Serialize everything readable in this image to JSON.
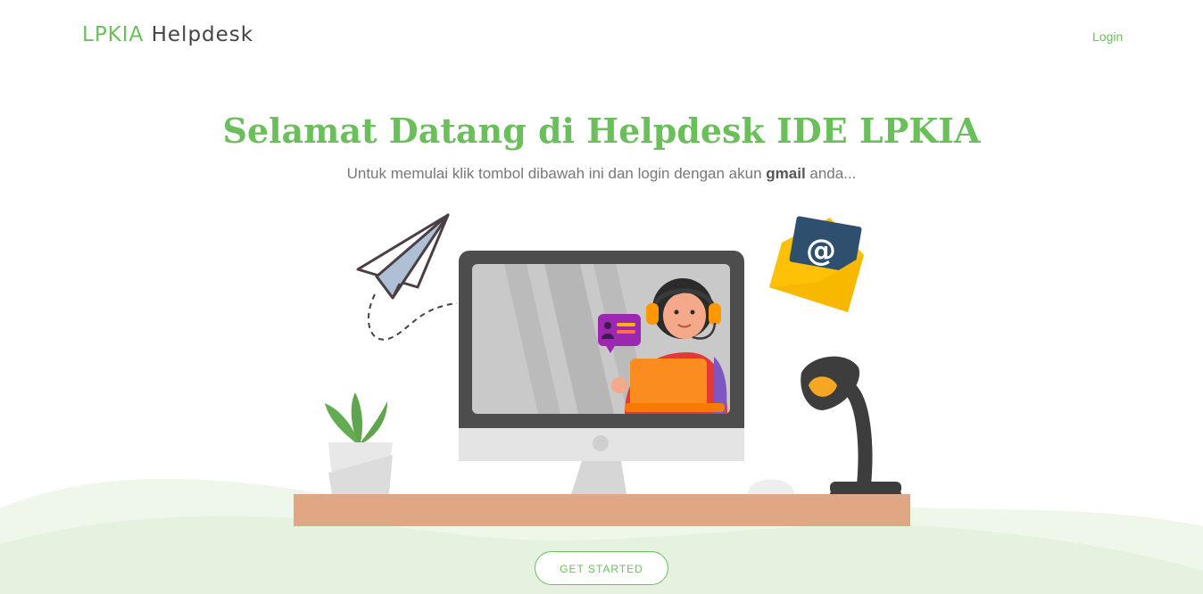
{
  "navbar": {
    "brand_primary": "LPKIA",
    "brand_secondary": "Helpdesk",
    "login_label": "Login"
  },
  "hero": {
    "title": "Selamat Datang di Helpdesk IDE LPKIA",
    "subtitle_before": "Untuk memulai klik tombol dibawah ini dan login dengan akun ",
    "subtitle_bold": "gmail",
    "subtitle_after": " anda...",
    "cta_label": "GET STARTED",
    "email_icon_symbol": "@"
  },
  "colors": {
    "accent": "#6bbf5a",
    "desk": "#e0a784",
    "hill": "#e8f4e4"
  }
}
